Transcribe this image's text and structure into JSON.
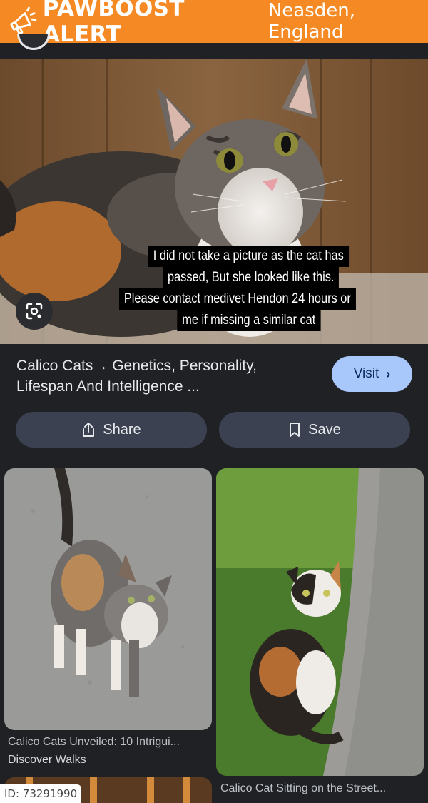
{
  "banner": {
    "brand": "PAWBOOST ALERT",
    "location": "Neasden, England",
    "icon": "megaphone-icon",
    "color": "#f58a24"
  },
  "hero": {
    "caption_lines": [
      "I did not take a picture as the cat has",
      "passed, But she looked like this.",
      "Please contact medivet Hendon 24 hours or",
      "me if missing a similar cat"
    ],
    "lens_icon": "lens-search-icon"
  },
  "result": {
    "title": "Calico Cats→ Genetics, Personality, Lifespan And Intelligence ...",
    "visit_label": "Visit",
    "visit_color": "#a8c7fa"
  },
  "actions": {
    "share_label": "Share",
    "save_label": "Save"
  },
  "related": [
    {
      "title": "Calico Cats Unveiled: 10 Intrigui...",
      "source": "Discover Walks"
    },
    {
      "title": "Calico Cat Sitting on the Street..."
    }
  ],
  "listing": {
    "id_label": "ID: 73291990"
  }
}
